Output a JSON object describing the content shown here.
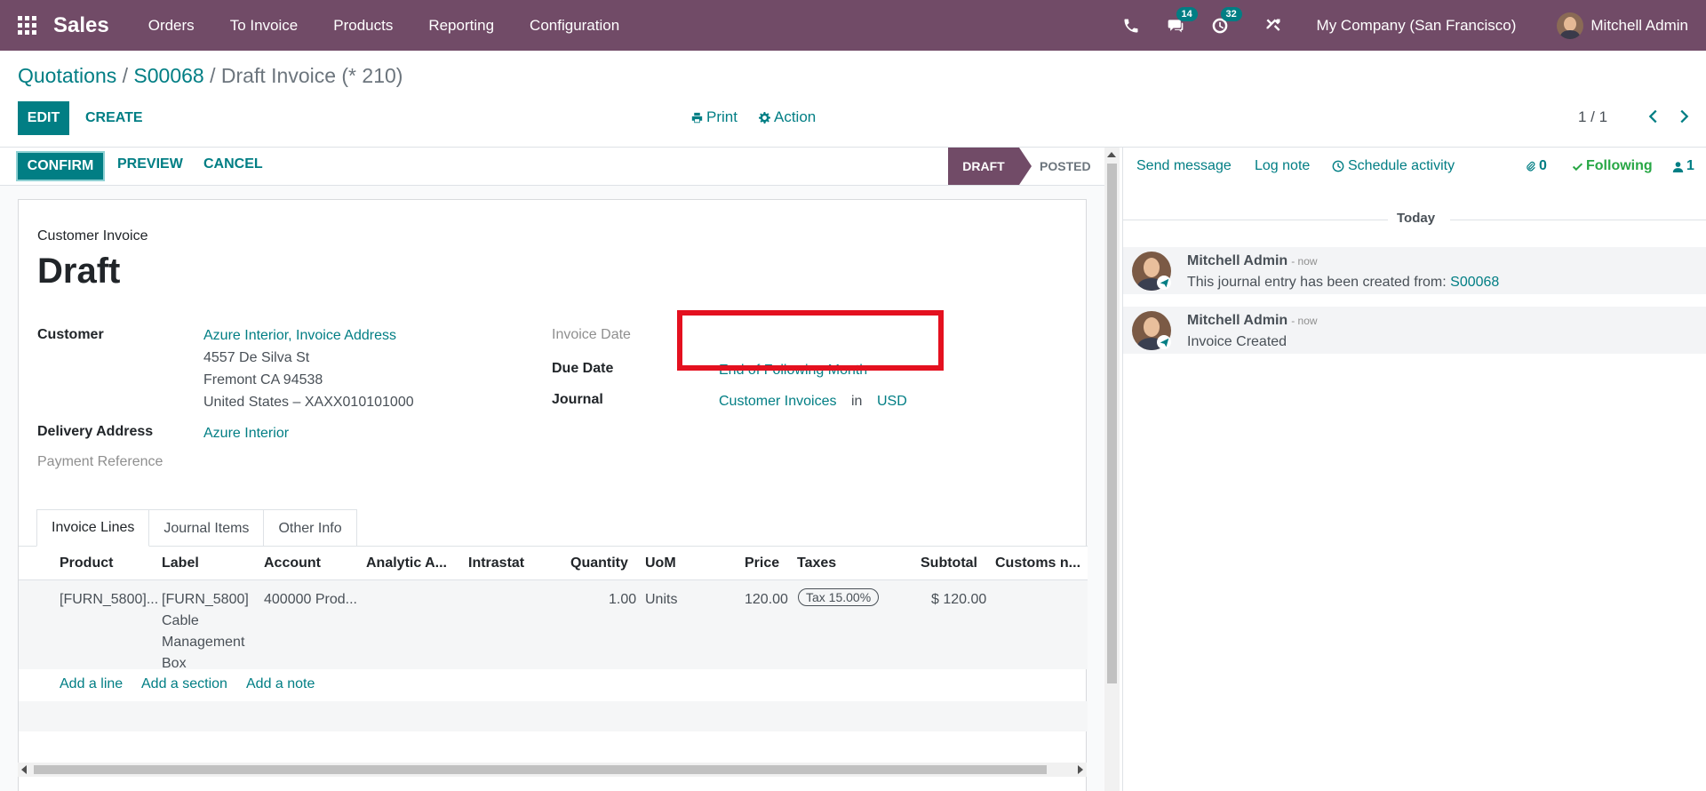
{
  "navbar": {
    "app_name": "Sales",
    "menu": [
      "Orders",
      "To Invoice",
      "Products",
      "Reporting",
      "Configuration"
    ],
    "messages_count": "14",
    "activities_count": "32",
    "company": "My Company (San Francisco)",
    "user": "Mitchell Admin",
    "bg_color": "#714b67"
  },
  "breadcrumb": {
    "quotations": "Quotations",
    "sep1": " / ",
    "order": "S00068",
    "sep2": " / ",
    "current": "Draft Invoice (* 210)"
  },
  "control": {
    "edit": "EDIT",
    "create": "CREATE",
    "print": "Print",
    "action": "Action",
    "pager": "1 / 1"
  },
  "statusbar": {
    "confirm": "CONFIRM",
    "preview": "PREVIEW",
    "cancel": "CANCEL",
    "stage_draft": "DRAFT",
    "stage_posted": "POSTED"
  },
  "invoice": {
    "type_label": "Customer Invoice",
    "title": "Draft",
    "customer_label": "Customer",
    "customer_name": "Azure Interior, Invoice Address",
    "address_line1": "4557 De Silva St",
    "address_line2": "Fremont CA 94538",
    "address_line3": "United States – XAXX010101000",
    "delivery_label": "Delivery Address",
    "delivery_value": "Azure Interior",
    "payment_ref_label": "Payment Reference",
    "invoice_date_label": "Invoice Date",
    "due_date_label": "Due Date",
    "due_date_value": "End of Following Month",
    "journal_label": "Journal",
    "journal_value": "Customer Invoices",
    "journal_in": "in",
    "currency": "USD"
  },
  "tabs": [
    "Invoice Lines",
    "Journal Items",
    "Other Info"
  ],
  "table": {
    "columns": [
      "Product",
      "Label",
      "Account",
      "Analytic A...",
      "Intrastat",
      "Quantity",
      "UoM",
      "Price",
      "Taxes",
      "Subtotal",
      "Customs n..."
    ],
    "row": {
      "product": "[FURN_5800]...",
      "label_lines": [
        "[FURN_5800]",
        "Cable",
        "Management",
        "Box"
      ],
      "account": "400000 Prod...",
      "quantity": "1.00",
      "uom": "Units",
      "price": "120.00",
      "tax": "Tax 15.00%",
      "subtotal": "$ 120.00"
    },
    "add_line": "Add a line",
    "add_section": "Add a section",
    "add_note": "Add a note"
  },
  "chatter": {
    "send_message": "Send message",
    "log_note": "Log note",
    "schedule_activity": "Schedule activity",
    "attachments": "0",
    "following": "Following",
    "followers": "1",
    "today": "Today",
    "messages": [
      {
        "author": "Mitchell Admin",
        "when": "- now",
        "body": "This journal entry has been created from: ",
        "link": "S00068"
      },
      {
        "author": "Mitchell Admin",
        "when": "- now",
        "body": "Invoice Created",
        "link": ""
      }
    ]
  },
  "colors": {
    "primary": "#017e84",
    "brand": "#714b67",
    "highlight": "#e4101f"
  }
}
